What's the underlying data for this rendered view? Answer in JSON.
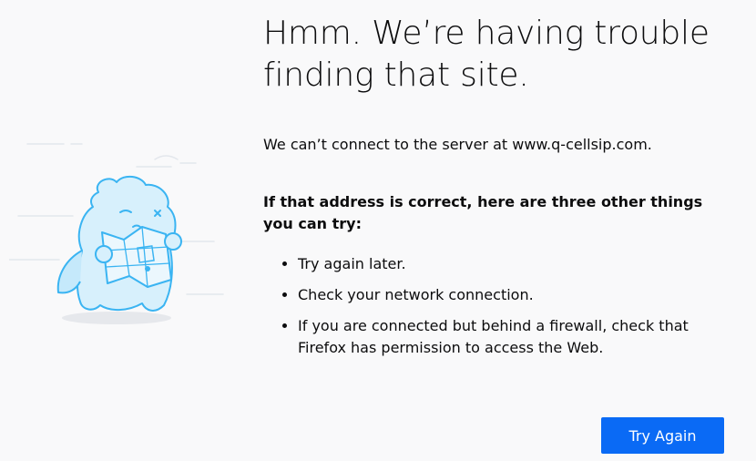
{
  "error": {
    "title": "Hmm. We’re having trouble finding that site.",
    "short_desc": "We can’t connect to the server at www.q-cellsip.com.",
    "try_heading": "If that address is correct, here are three other things you can try:",
    "suggestions": [
      "Try again later.",
      "Check your network connection.",
      "If you are connected but behind a firewall, check that Firefox has permission to access the Web."
    ],
    "button_label": "Try Again"
  },
  "colors": {
    "background": "#f9f9fa",
    "accent": "#0a6af5",
    "illustration_stroke": "#3ab4f2",
    "illustration_fill": "#d7f0fc"
  },
  "icons": {
    "illustration": "lost-map-creature-icon"
  }
}
